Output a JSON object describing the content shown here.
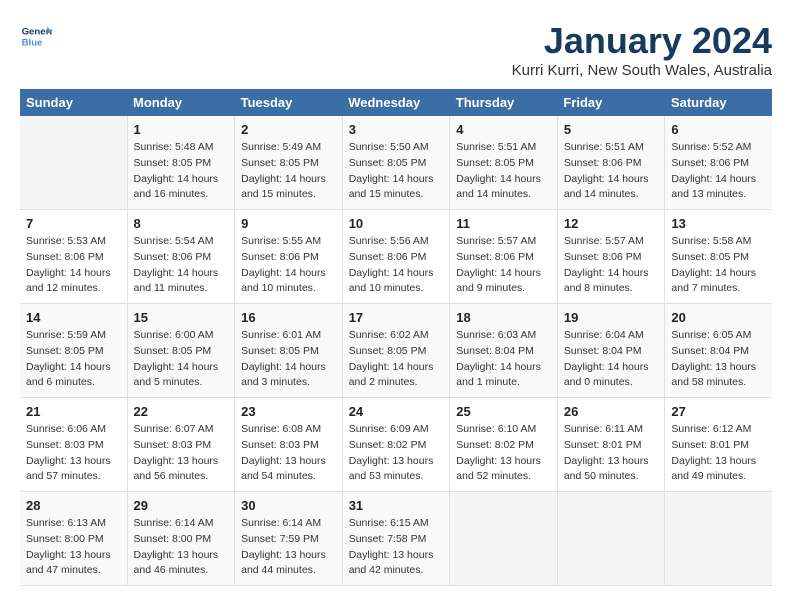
{
  "logo": {
    "line1": "General",
    "line2": "Blue"
  },
  "title": "January 2024",
  "subtitle": "Kurri Kurri, New South Wales, Australia",
  "days_header": [
    "Sunday",
    "Monday",
    "Tuesday",
    "Wednesday",
    "Thursday",
    "Friday",
    "Saturday"
  ],
  "weeks": [
    [
      {
        "day": "",
        "info": ""
      },
      {
        "day": "1",
        "info": "Sunrise: 5:48 AM\nSunset: 8:05 PM\nDaylight: 14 hours\nand 16 minutes."
      },
      {
        "day": "2",
        "info": "Sunrise: 5:49 AM\nSunset: 8:05 PM\nDaylight: 14 hours\nand 15 minutes."
      },
      {
        "day": "3",
        "info": "Sunrise: 5:50 AM\nSunset: 8:05 PM\nDaylight: 14 hours\nand 15 minutes."
      },
      {
        "day": "4",
        "info": "Sunrise: 5:51 AM\nSunset: 8:05 PM\nDaylight: 14 hours\nand 14 minutes."
      },
      {
        "day": "5",
        "info": "Sunrise: 5:51 AM\nSunset: 8:06 PM\nDaylight: 14 hours\nand 14 minutes."
      },
      {
        "day": "6",
        "info": "Sunrise: 5:52 AM\nSunset: 8:06 PM\nDaylight: 14 hours\nand 13 minutes."
      }
    ],
    [
      {
        "day": "7",
        "info": "Sunrise: 5:53 AM\nSunset: 8:06 PM\nDaylight: 14 hours\nand 12 minutes."
      },
      {
        "day": "8",
        "info": "Sunrise: 5:54 AM\nSunset: 8:06 PM\nDaylight: 14 hours\nand 11 minutes."
      },
      {
        "day": "9",
        "info": "Sunrise: 5:55 AM\nSunset: 8:06 PM\nDaylight: 14 hours\nand 10 minutes."
      },
      {
        "day": "10",
        "info": "Sunrise: 5:56 AM\nSunset: 8:06 PM\nDaylight: 14 hours\nand 10 minutes."
      },
      {
        "day": "11",
        "info": "Sunrise: 5:57 AM\nSunset: 8:06 PM\nDaylight: 14 hours\nand 9 minutes."
      },
      {
        "day": "12",
        "info": "Sunrise: 5:57 AM\nSunset: 8:06 PM\nDaylight: 14 hours\nand 8 minutes."
      },
      {
        "day": "13",
        "info": "Sunrise: 5:58 AM\nSunset: 8:05 PM\nDaylight: 14 hours\nand 7 minutes."
      }
    ],
    [
      {
        "day": "14",
        "info": "Sunrise: 5:59 AM\nSunset: 8:05 PM\nDaylight: 14 hours\nand 6 minutes."
      },
      {
        "day": "15",
        "info": "Sunrise: 6:00 AM\nSunset: 8:05 PM\nDaylight: 14 hours\nand 5 minutes."
      },
      {
        "day": "16",
        "info": "Sunrise: 6:01 AM\nSunset: 8:05 PM\nDaylight: 14 hours\nand 3 minutes."
      },
      {
        "day": "17",
        "info": "Sunrise: 6:02 AM\nSunset: 8:05 PM\nDaylight: 14 hours\nand 2 minutes."
      },
      {
        "day": "18",
        "info": "Sunrise: 6:03 AM\nSunset: 8:04 PM\nDaylight: 14 hours\nand 1 minute."
      },
      {
        "day": "19",
        "info": "Sunrise: 6:04 AM\nSunset: 8:04 PM\nDaylight: 14 hours\nand 0 minutes."
      },
      {
        "day": "20",
        "info": "Sunrise: 6:05 AM\nSunset: 8:04 PM\nDaylight: 13 hours\nand 58 minutes."
      }
    ],
    [
      {
        "day": "21",
        "info": "Sunrise: 6:06 AM\nSunset: 8:03 PM\nDaylight: 13 hours\nand 57 minutes."
      },
      {
        "day": "22",
        "info": "Sunrise: 6:07 AM\nSunset: 8:03 PM\nDaylight: 13 hours\nand 56 minutes."
      },
      {
        "day": "23",
        "info": "Sunrise: 6:08 AM\nSunset: 8:03 PM\nDaylight: 13 hours\nand 54 minutes."
      },
      {
        "day": "24",
        "info": "Sunrise: 6:09 AM\nSunset: 8:02 PM\nDaylight: 13 hours\nand 53 minutes."
      },
      {
        "day": "25",
        "info": "Sunrise: 6:10 AM\nSunset: 8:02 PM\nDaylight: 13 hours\nand 52 minutes."
      },
      {
        "day": "26",
        "info": "Sunrise: 6:11 AM\nSunset: 8:01 PM\nDaylight: 13 hours\nand 50 minutes."
      },
      {
        "day": "27",
        "info": "Sunrise: 6:12 AM\nSunset: 8:01 PM\nDaylight: 13 hours\nand 49 minutes."
      }
    ],
    [
      {
        "day": "28",
        "info": "Sunrise: 6:13 AM\nSunset: 8:00 PM\nDaylight: 13 hours\nand 47 minutes."
      },
      {
        "day": "29",
        "info": "Sunrise: 6:14 AM\nSunset: 8:00 PM\nDaylight: 13 hours\nand 46 minutes."
      },
      {
        "day": "30",
        "info": "Sunrise: 6:14 AM\nSunset: 7:59 PM\nDaylight: 13 hours\nand 44 minutes."
      },
      {
        "day": "31",
        "info": "Sunrise: 6:15 AM\nSunset: 7:58 PM\nDaylight: 13 hours\nand 42 minutes."
      },
      {
        "day": "",
        "info": ""
      },
      {
        "day": "",
        "info": ""
      },
      {
        "day": "",
        "info": ""
      }
    ]
  ]
}
